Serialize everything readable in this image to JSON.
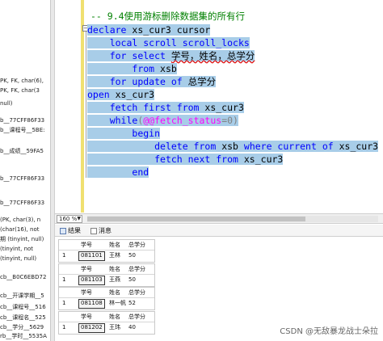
{
  "explorer": {
    "items": [
      "PK, FK, char(6),",
      "PK, FK, char(3",
      "null)",
      "b__77CFF86F33",
      "b__课程号__5BE:",
      "b__成绩__59FA5",
      "b__77CFF86F33",
      "b__77CFF86F33",
      "(PK, char(3), n",
      "(char(16), not",
      "期 (tinyint, null)",
      "(tinyint, not",
      "(tinyint, null)",
      "cb__B0C6EBD72",
      "cb__开课学期__5",
      "cb__课程号__516",
      "cb__课程名__525",
      "cb__学分__5629",
      "rb__学时__5535A"
    ]
  },
  "editor": {
    "comment": "-- 9.4使用游标删除数据集的所有行",
    "lines": {
      "l1_kw": "declare",
      "l1_rest": " xs_cur3 cursor",
      "l2_kw": "local scroll scroll_locks",
      "l3_kw": "for select",
      "l3_cols": "学号，姓名，总学分",
      "l4_kw": "from",
      "l4_tbl": " xsb",
      "l5_kw": "for update of",
      "l5_col": "总学分",
      "l6_kw": "open",
      "l6_rest": " xs_cur3",
      "l7_kw": "fetch first from",
      "l7_rest": " xs_cur3",
      "l8_kw": "while",
      "l8_paren": "(",
      "l8_var": "@@fetch_status",
      "l8_eq": "=0)",
      "l9_kw": "begin",
      "l10_kw1": "delete from",
      "l10_tbl": " xsb ",
      "l10_kw2": "where current of",
      "l10_rest": " xs_cur3",
      "l11_kw": "fetch next from",
      "l11_rest": " xs_cur3",
      "l12_kw": "end"
    }
  },
  "zoom": {
    "value": "160 %"
  },
  "tabs": {
    "results": "结果",
    "messages": "消息"
  },
  "results": {
    "columns": [
      "学号",
      "姓名",
      "总学分"
    ],
    "grids": [
      {
        "row_num": "1",
        "cells": [
          "081101",
          "王林",
          "50"
        ]
      },
      {
        "row_num": "1",
        "cells": [
          "081103",
          "王燕",
          "50"
        ]
      },
      {
        "row_num": "1",
        "cells": [
          "081108",
          "林一帆",
          "52"
        ]
      },
      {
        "row_num": "1",
        "cells": [
          "081202",
          "王玮",
          "40"
        ]
      }
    ]
  },
  "watermark": "CSDN @无敌暴龙战士朵拉"
}
